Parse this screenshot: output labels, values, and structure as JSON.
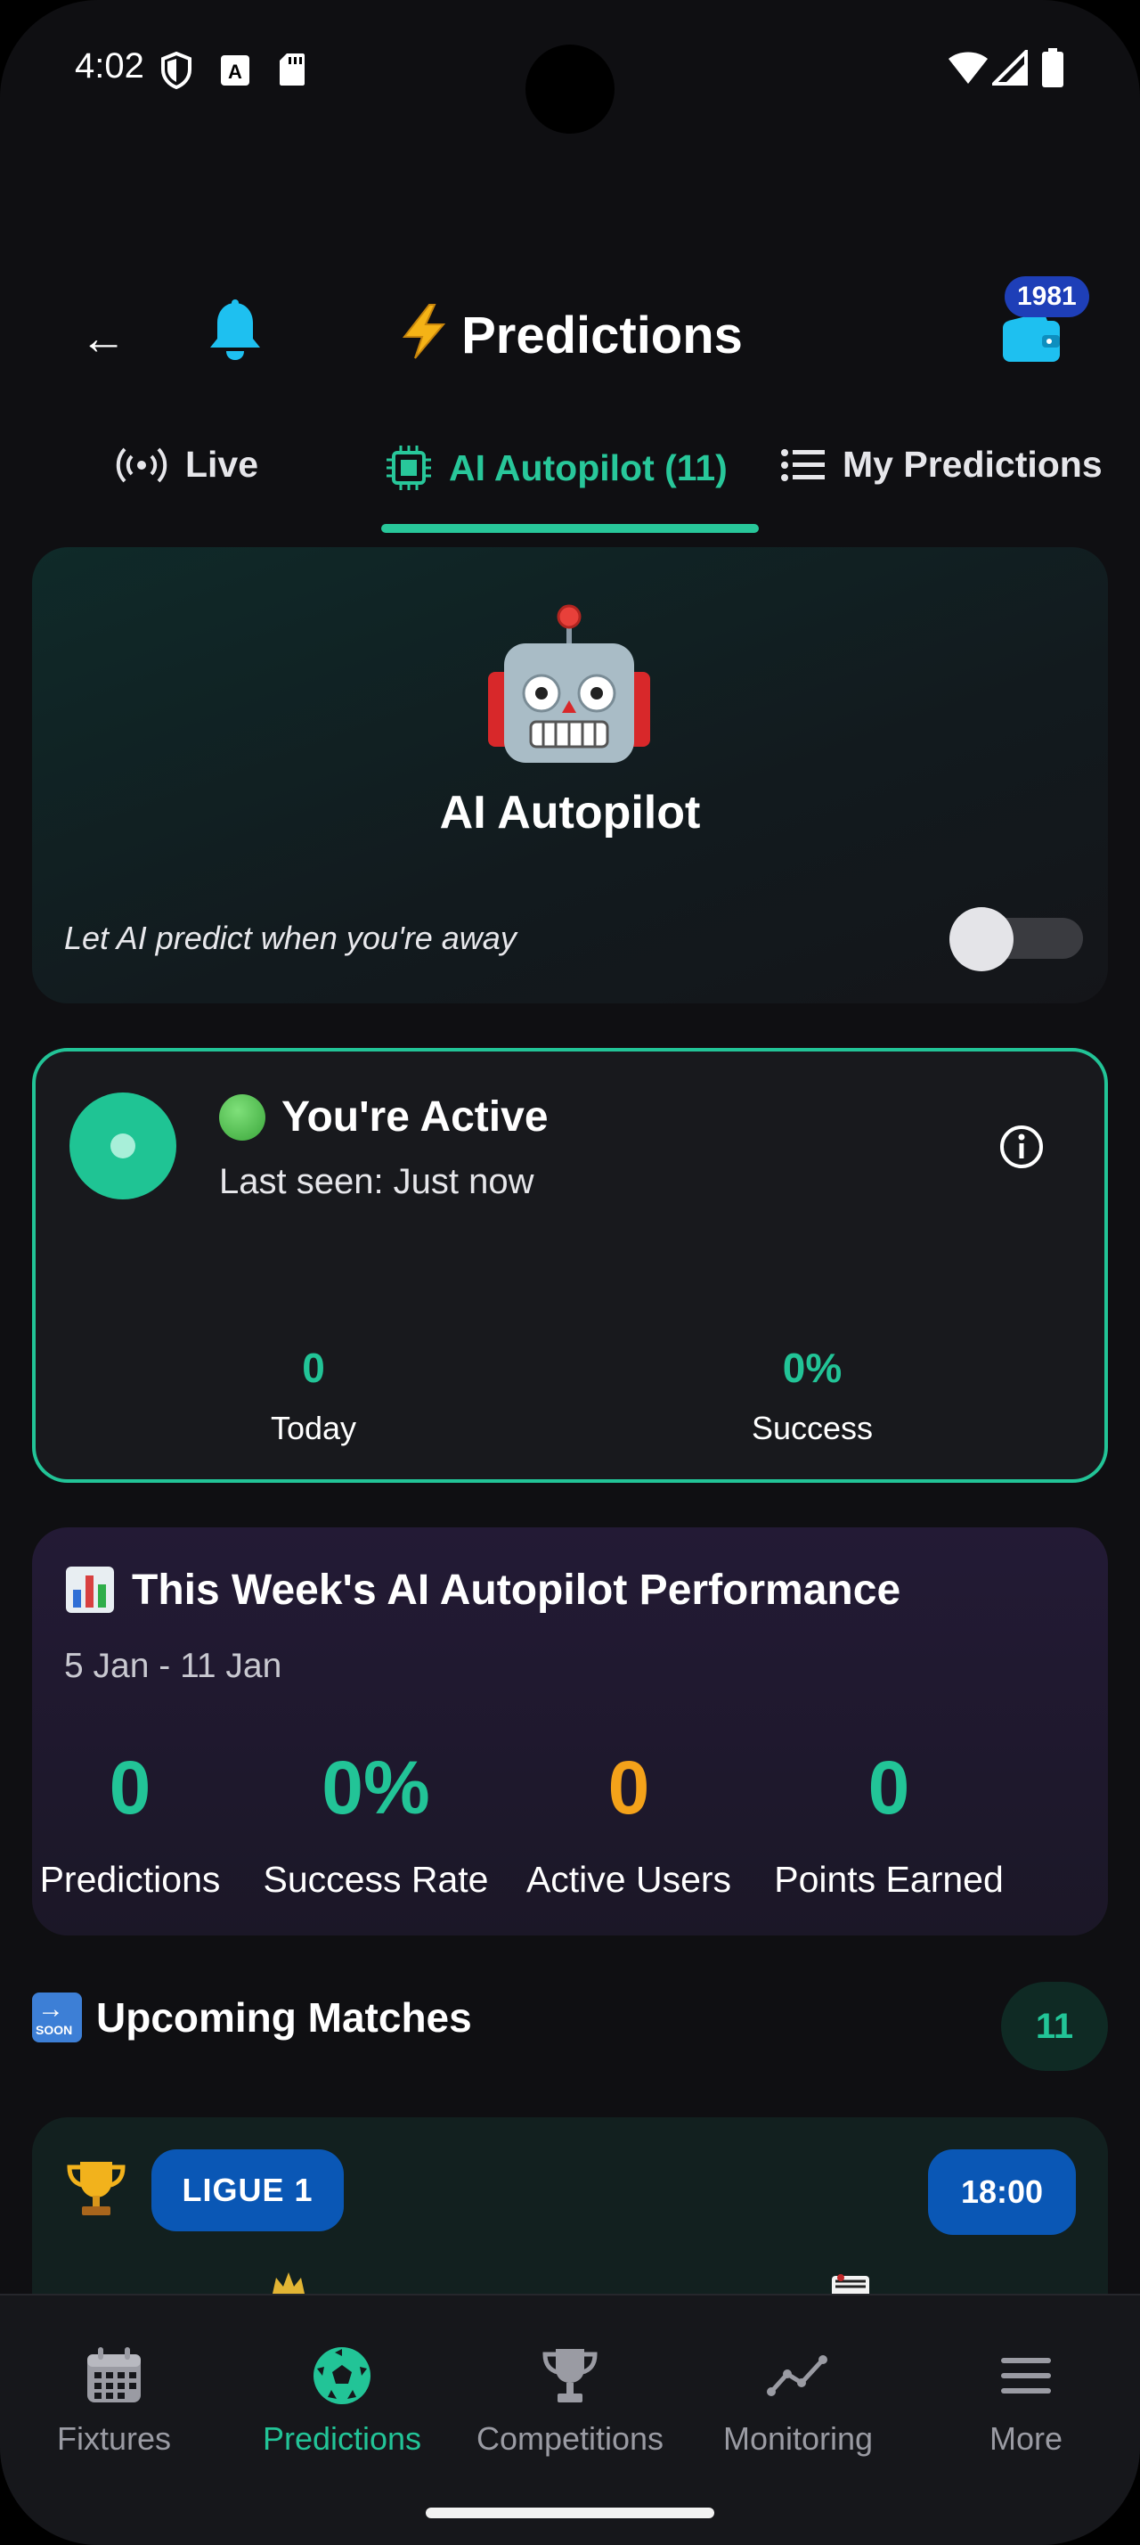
{
  "status_bar": {
    "time": "4:02"
  },
  "header": {
    "back_label": "←",
    "title": "Predictions",
    "wallet_badge": "1981"
  },
  "tabs": [
    {
      "label": "Live",
      "icon": "broadcast-icon"
    },
    {
      "label": "AI Autopilot (11)",
      "icon": "chip-icon",
      "active": true
    },
    {
      "label": "My Predictions",
      "icon": "list-icon"
    }
  ],
  "autopilot": {
    "title": "AI Autopilot",
    "subtitle": "Let AI predict when you're away",
    "toggle_on": false
  },
  "active_card": {
    "title": "You're Active",
    "last_seen": "Last seen: Just now",
    "today_value": "0",
    "today_label": "Today",
    "success_value": "0%",
    "success_label": "Success"
  },
  "weekly": {
    "title": "This Week's AI Autopilot Performance",
    "range": "5 Jan - 11 Jan",
    "stats": [
      {
        "value": "0",
        "label": "Predictions",
        "color": "#22c497"
      },
      {
        "value": "0%",
        "label": "Success Rate",
        "color": "#22c497"
      },
      {
        "value": "0",
        "label": "Active Users",
        "color": "#f4a21a"
      },
      {
        "value": "0",
        "label": "Points Earned",
        "color": "#22c497"
      }
    ]
  },
  "upcoming": {
    "title": "Upcoming Matches",
    "count": "11",
    "soon_label": "SOON"
  },
  "match": {
    "league": "LIGUE 1",
    "time": "18:00"
  },
  "bottom_nav": [
    {
      "label": "Fixtures",
      "icon": "calendar-icon"
    },
    {
      "label": "Predictions",
      "icon": "soccer-ball-icon",
      "active": true
    },
    {
      "label": "Competitions",
      "icon": "trophy-icon"
    },
    {
      "label": "Monitoring",
      "icon": "line-chart-icon"
    },
    {
      "label": "More",
      "icon": "menu-icon"
    }
  ],
  "colors": {
    "accent": "#22c497",
    "badge_blue": "#0a57b5",
    "warning": "#f4a21a"
  }
}
